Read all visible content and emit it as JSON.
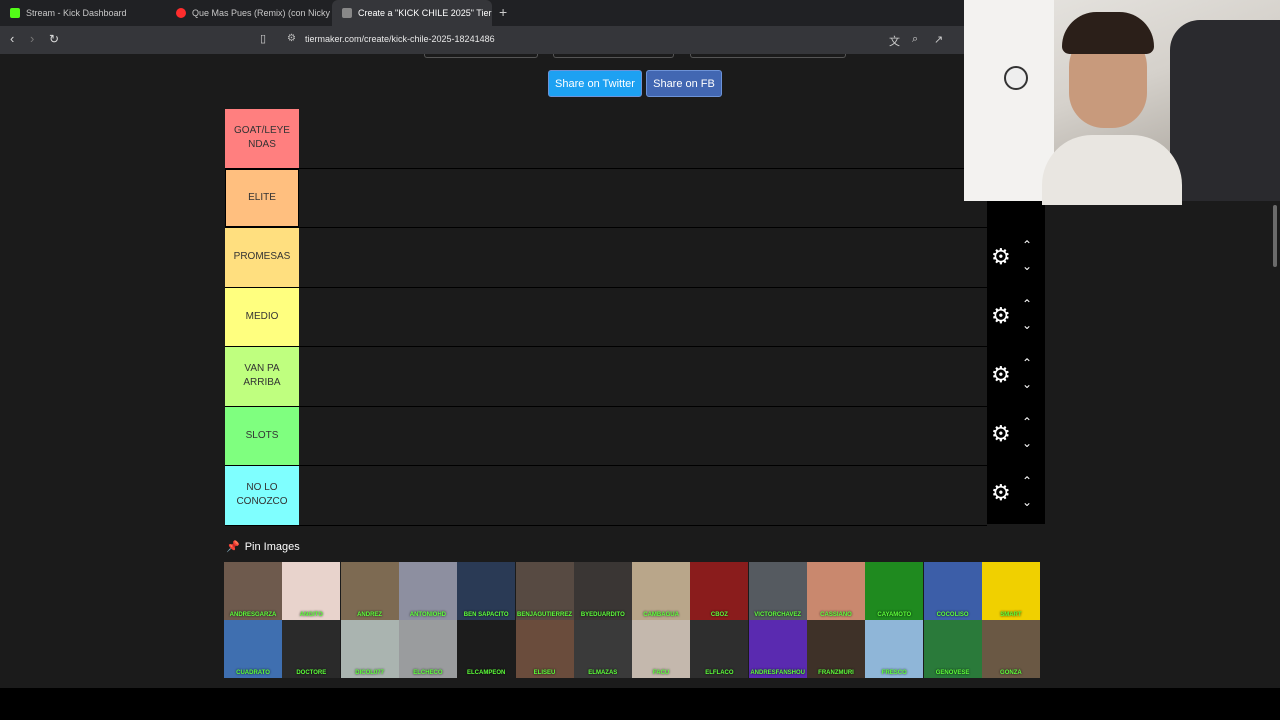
{
  "browser": {
    "tabs": [
      {
        "title": "Stream - Kick Dashboard",
        "favicon_color": "#53fc18"
      },
      {
        "title": "Que Mas Pues (Remix) (con Nicky",
        "favicon_color": "#ff2d2d"
      },
      {
        "title": "Create a \"KICK CHILE 2025\" Tier",
        "favicon_color": "#888888",
        "close": "✕"
      }
    ],
    "url": "tiermaker.com/create/kick-chile-2025-18241486"
  },
  "share": {
    "twitter": "Share on Twitter",
    "facebook": "Share on FB"
  },
  "tiers": [
    {
      "label": "GOAT/LEYE\nNDAS",
      "color": "#ff7f7f"
    },
    {
      "label": "ELITE",
      "color": "#ffbf7f"
    },
    {
      "label": "PROMESAS",
      "color": "#ffdf7f"
    },
    {
      "label": "MEDIO",
      "color": "#ffff7f"
    },
    {
      "label": "VAN PA\nARRIBA",
      "color": "#bfff7f"
    },
    {
      "label": "SLOTS",
      "color": "#7fff7f"
    },
    {
      "label": "NO LO\nCONOZCO",
      "color": "#7fffff"
    }
  ],
  "pin_images": {
    "label": "Pin Images",
    "icon": "pin-icon"
  },
  "pool": {
    "row1": [
      {
        "caption": "ANDRESGARZA",
        "color": "#6e5a4d"
      },
      {
        "caption": "ANGITO",
        "color": "#e8d3cc"
      },
      {
        "caption": "ANDREZ",
        "color": "#7d6a52"
      },
      {
        "caption": "ANTONIOHD",
        "color": "#8d8fa0"
      },
      {
        "caption": "BEN SAPACITO",
        "color": "#2a3a55"
      },
      {
        "caption": "BENJAGUTIERREZ",
        "color": "#574a42"
      },
      {
        "caption": "BYEDUARDITO",
        "color": "#3a3634"
      },
      {
        "caption": "CAMBAGUA",
        "color": "#b9a68a"
      },
      {
        "caption": "CBOZ",
        "color": "#8a1c1c"
      },
      {
        "caption": "VICTORCHAVEZ",
        "color": "#555a60"
      },
      {
        "caption": "CASSIANO",
        "color": "#c9886e"
      },
      {
        "caption": "CAYAMOTO",
        "color": "#1f8a1f"
      },
      {
        "caption": "COCOLISO",
        "color": "#3c5ea8"
      },
      {
        "caption": "SMART",
        "color": "#f0d000"
      }
    ],
    "row2": [
      {
        "caption": "CUADRATO",
        "color": "#3f6fb0"
      },
      {
        "caption": "DOCTORE",
        "color": "#2a2a2a"
      },
      {
        "caption": "DICOL077",
        "color": "#aab4b0"
      },
      {
        "caption": "ELCHECO",
        "color": "#9a9c9e"
      },
      {
        "caption": "ELCAMPEON",
        "color": "#1c1c1c"
      },
      {
        "caption": "ELISEU",
        "color": "#6a4c3c"
      },
      {
        "caption": "ELMAZAS",
        "color": "#3a3a3a"
      },
      {
        "caption": "FACU",
        "color": "#c4b8ad"
      },
      {
        "caption": "ELFLACO",
        "color": "#2e2e2e"
      },
      {
        "caption": "ANDRESFANSHOU",
        "color": "#5a2ab0"
      },
      {
        "caption": "FRANZMURI",
        "color": "#3e3128"
      },
      {
        "caption": "FRESCO",
        "color": "#8fb6d8"
      },
      {
        "caption": "GENOVESE",
        "color": "#2a7a3a"
      },
      {
        "caption": "GONZA",
        "color": "#6a5844"
      }
    ]
  }
}
